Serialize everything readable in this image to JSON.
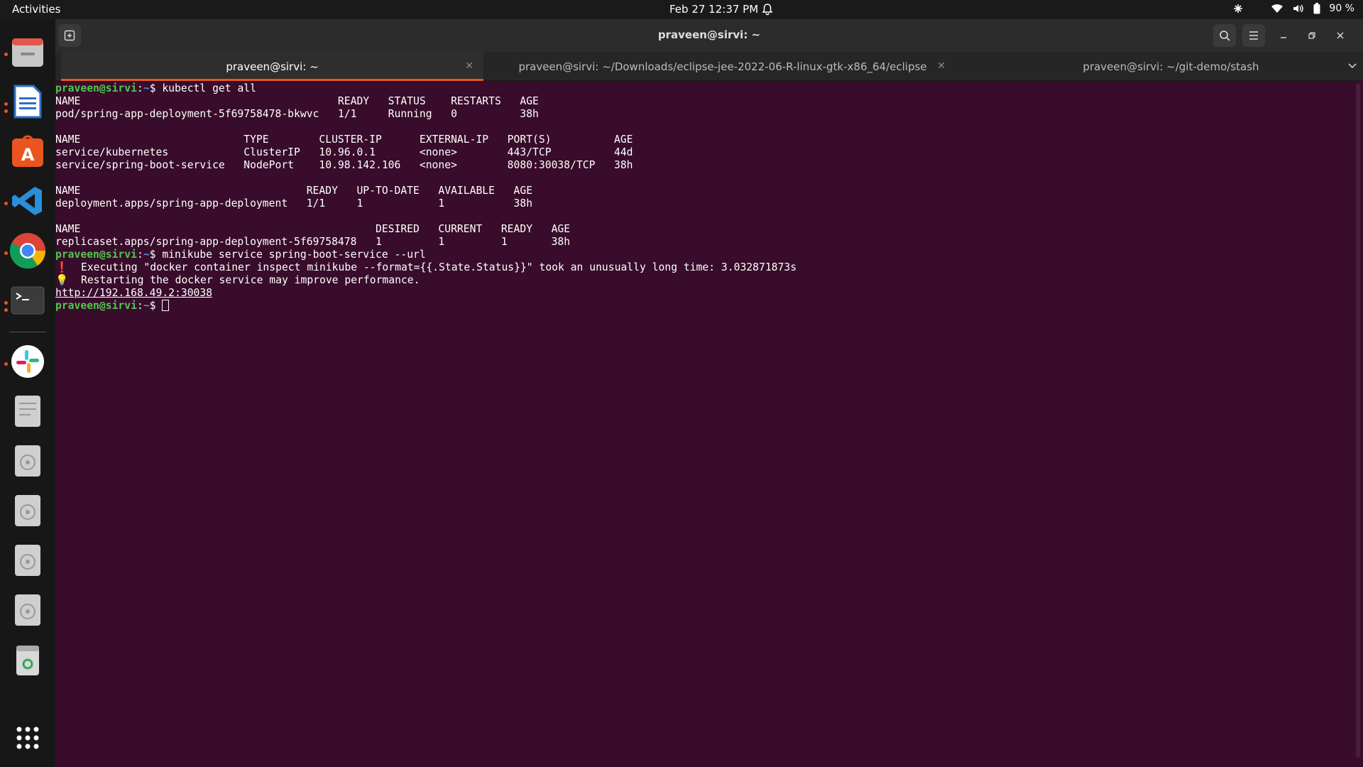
{
  "topbar": {
    "activities": "Activities",
    "clock": "Feb 27  12:37 PM",
    "battery": "90 %"
  },
  "dock": {
    "apps": [
      {
        "name": "files",
        "running": true
      },
      {
        "name": "libreoffice-writer",
        "running": true
      },
      {
        "name": "app-center",
        "running": false
      },
      {
        "name": "vscode",
        "running": true
      },
      {
        "name": "chrome",
        "running": true
      },
      {
        "name": "terminal",
        "running": true
      },
      {
        "name": "slack",
        "running": true
      },
      {
        "name": "text-editor",
        "running": false
      },
      {
        "name": "disk-1",
        "running": false
      },
      {
        "name": "disk-2",
        "running": false
      },
      {
        "name": "disk-3",
        "running": false
      },
      {
        "name": "disk-4",
        "running": false
      },
      {
        "name": "trash",
        "running": false
      },
      {
        "name": "show-apps",
        "running": false
      }
    ]
  },
  "window": {
    "title": "praveen@sirvi: ~",
    "tabs": [
      {
        "label": "praveen@sirvi: ~",
        "active": true
      },
      {
        "label": "praveen@sirvi: ~/Downloads/eclipse-jee-2022-06-R-linux-gtk-x86_64/eclipse",
        "active": false
      },
      {
        "label": "praveen@sirvi: ~/git-demo/stash",
        "active": false
      }
    ]
  },
  "terminal": {
    "prompt_user": "praveen@sirvi",
    "prompt_sep": ":",
    "prompt_path": "~",
    "prompt_end": "$ ",
    "cmd1": "kubectl get all",
    "out1": [
      "NAME                                         READY   STATUS    RESTARTS   AGE",
      "pod/spring-app-deployment-5f69758478-bkwvc   1/1     Running   0          38h",
      "",
      "NAME                          TYPE        CLUSTER-IP      EXTERNAL-IP   PORT(S)          AGE",
      "service/kubernetes            ClusterIP   10.96.0.1       <none>        443/TCP          44d",
      "service/spring-boot-service   NodePort    10.98.142.106   <none>        8080:30038/TCP   38h",
      "",
      "NAME                                    READY   UP-TO-DATE   AVAILABLE   AGE",
      "deployment.apps/spring-app-deployment   1/1     1            1           38h",
      "",
      "NAME                                               DESIRED   CURRENT   READY   AGE",
      "replicaset.apps/spring-app-deployment-5f69758478   1         1         1       38h"
    ],
    "cmd2": "minikube service spring-boot-service --url",
    "warn_icon": "❗",
    "warn_text": "  Executing \"docker container inspect minikube --format={{.State.Status}}\" took an unusually long time: 3.032871873s",
    "tip_icon": "💡",
    "tip_text": "  Restarting the docker service may improve performance.",
    "url": "http://192.168.49.2:30038"
  }
}
